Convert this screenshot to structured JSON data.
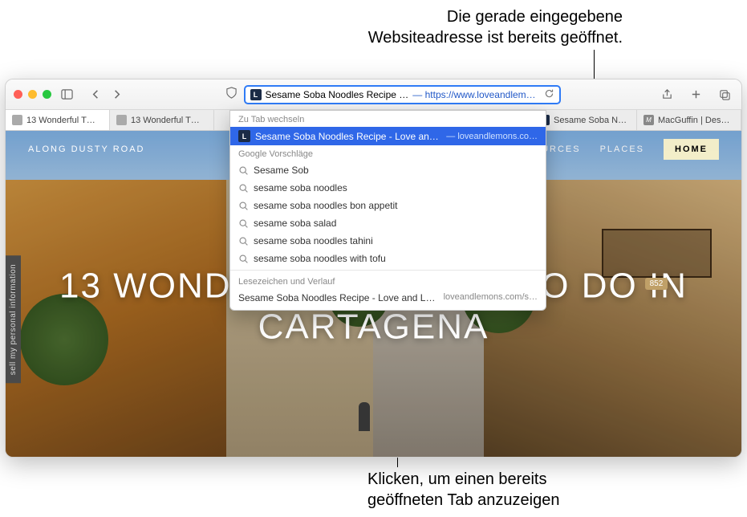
{
  "annotations": {
    "top": "Die gerade eingegebene\nWebsiteadresse ist bereits geöffnet.",
    "bottom": "Klicken, um einen bereits\ngeöffneten Tab anzuzeigen"
  },
  "toolbar": {
    "address_title": "Sesame Soba Noodles Recipe …",
    "address_url": "— https://www.loveandlemons.c…",
    "favicon_letter": "L"
  },
  "tabs": [
    {
      "label": "13 Wonderful T…",
      "fav": ""
    },
    {
      "label": "13 Wonderful T…",
      "fav": ""
    },
    {
      "label": "Sesame Soba N…",
      "fav": "L",
      "favclass": "dark"
    },
    {
      "label": "MacGuffin | Des…",
      "fav": "M",
      "favclass": "m"
    }
  ],
  "dropdown": {
    "section_switch": "Zu Tab wechseln",
    "switch_item": {
      "title": "Sesame Soba Noodles Recipe - Love and Lemons",
      "sub": "— loveandlemons.co…",
      "fav": "L"
    },
    "section_google": "Google Vorschläge",
    "suggestions": [
      "Sesame Sob",
      "sesame soba noodles",
      "sesame soba noodles bon appetit",
      "sesame soba salad",
      "sesame soba noodles tahini",
      "sesame soba noodles with tofu"
    ],
    "section_history": "Lesezeichen und Verlauf",
    "history_item": {
      "title": "Sesame Soba Noodles Recipe - Love and Lemo…",
      "url": "loveandlemons.com/s…"
    }
  },
  "page": {
    "brand": "ALONG DUSTY ROAD",
    "nav": {
      "sources": "SOURCES",
      "places": "PLACES",
      "home": "HOME"
    },
    "headline": "13 WONDERFUL THINGS TO DO IN CARTAGENA",
    "side_tab": "sell my personal information",
    "badge": "852"
  }
}
